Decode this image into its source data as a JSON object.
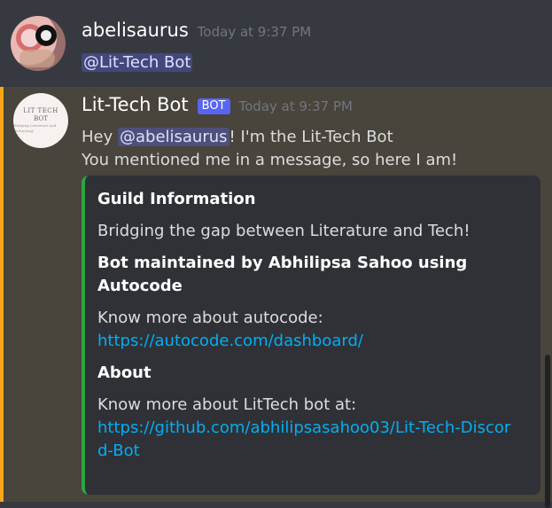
{
  "messages": [
    {
      "username": "abelisaurus",
      "timestamp": "Today at 9:37 PM",
      "content": "@Lit-Tech Bot",
      "avatar": "user-avatar-photo"
    },
    {
      "username": "Lit-Tech Bot",
      "bot_tag": "BOT",
      "timestamp": "Today at 9:37 PM",
      "avatar_text": [
        "LIT TECH",
        "BOT",
        "Bridging Literature and Technology"
      ],
      "line1_prefix": "Hey ",
      "line1_mention": "@abelisaurus",
      "line1_suffix": "! I'm the Lit-Tech Bot",
      "line2": "You mentioned me in a message, so here I am!",
      "embed": {
        "accent_color": "#2ba640",
        "fields": [
          {
            "name": "Guild Information",
            "value": "Bridging the gap between Literature and Tech!"
          },
          {
            "name": "Bot maintained by Abhilipsa Sahoo using Autocode",
            "value": "Know more about autocode:",
            "link": "https://autocode.com/dashboard/"
          },
          {
            "name": "About",
            "value": "Know more about LitTech bot at:",
            "link": "https://github.com/abhilipsasahoo03/Lit-Tech-Discord-Bot"
          }
        ]
      }
    }
  ],
  "colors": {
    "background": "#36393f",
    "highlight_background": "#49443c",
    "highlight_border": "#faa61a",
    "mention": "#5865f2",
    "link": "#00aff4"
  }
}
